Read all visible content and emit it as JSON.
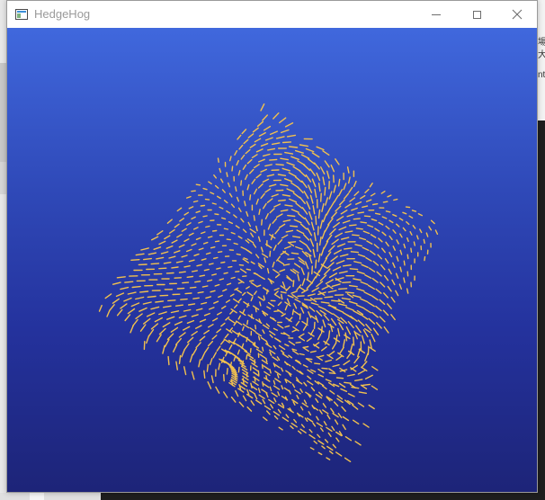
{
  "window": {
    "title": "HedgeHog",
    "minimize_label": "Minimize",
    "maximize_label": "Maximize",
    "close_label": "Close"
  },
  "viewport": {
    "background_top": "#4068dd",
    "background_bottom": "#1d2478",
    "glyph_color": "#f2c14e"
  },
  "background_fragments": {
    "right_edge_texts": [
      "場(",
      "大",
      "nt"
    ]
  }
}
